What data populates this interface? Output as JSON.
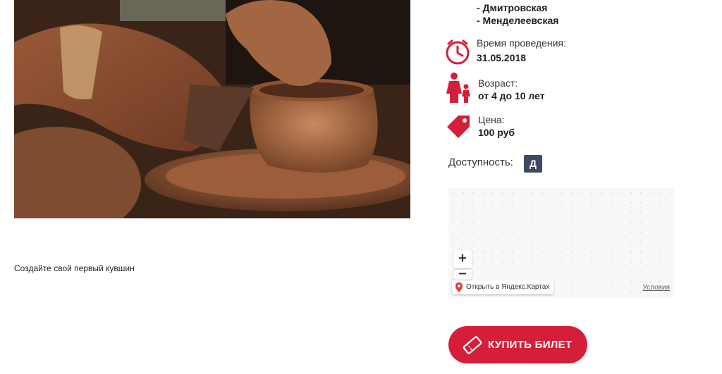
{
  "photo": {
    "alt": "Pottery wheel with clay pot"
  },
  "caption": "Создайте свой первый кувшин",
  "metro": [
    "- Дмитровская",
    "- Менделеевская"
  ],
  "time": {
    "label": "Время проведения:",
    "value": "31.05.2018",
    "icon": "clock-icon"
  },
  "age": {
    "label": "Возраст:",
    "value": "от 4 до 10 лет",
    "icon": "family-icon"
  },
  "price": {
    "label": "Цена:",
    "value": "100 руб",
    "icon": "price-tag-icon"
  },
  "accessibility": {
    "label": "Доступность:",
    "badge": "Д"
  },
  "map": {
    "zoom_in": "+",
    "zoom_out": "–",
    "open_label": "Открыть в Яндекс.Картах",
    "terms": "Условия"
  },
  "buy": {
    "label": "КУПИТЬ БИЛЕТ",
    "icon": "ticket-icon"
  },
  "colors": {
    "accent": "#d51f3a",
    "badge": "#3d4a63"
  }
}
